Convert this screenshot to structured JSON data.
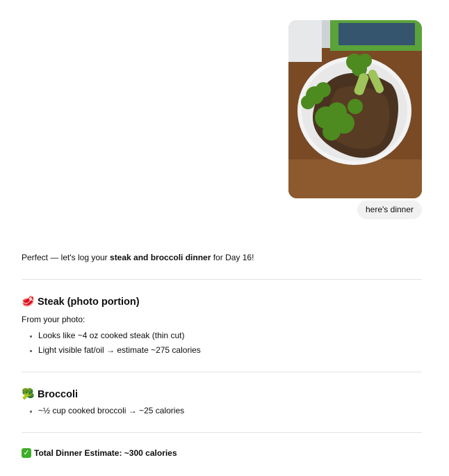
{
  "user_message": {
    "image_alt": "steak and broccoli on a white plate",
    "text": "here's dinner"
  },
  "assistant": {
    "intro_prefix": "Perfect — let's log your ",
    "intro_bold": "steak and broccoli dinner",
    "intro_suffix": " for Day 16!",
    "steak": {
      "icon": "steak-icon",
      "heading": "Steak (photo portion)",
      "subtext": "From your photo:",
      "bullets": [
        "Looks like ~4 oz cooked steak (thin cut)",
        "Light visible fat/oil → estimate ~275 calories"
      ]
    },
    "broccoli": {
      "icon": "broccoli-icon",
      "heading": "Broccoli",
      "bullets": [
        "~½ cup cooked broccoli → ~25 calories"
      ]
    },
    "total": {
      "icon": "check-icon",
      "text": "Total Dinner Estimate: ~300 calories"
    }
  },
  "colors": {
    "bubble": "#f1f1f1",
    "divider": "#e3e3e3",
    "check": "#3fae2a"
  }
}
